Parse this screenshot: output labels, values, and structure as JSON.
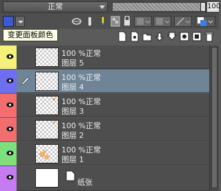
{
  "blend": {
    "mode": "正常",
    "opacity": "100"
  },
  "tooltip": {
    "text": "变更面板颜色"
  },
  "colors": {
    "panel_accent": "#3d59d8",
    "selected_row": "#6f8597"
  },
  "layers": [
    {
      "opacity_mode": "100 %正常",
      "name": "图层 5",
      "strip": "#f5f07a",
      "selected": false,
      "thumb": "checker"
    },
    {
      "opacity_mode": "100 %正常",
      "name": "图层 4",
      "strip": "#6e6ef0",
      "selected": true,
      "thumb": "checker"
    },
    {
      "opacity_mode": "100 %正常",
      "name": "图层 3",
      "strip": "#f26e6e",
      "selected": false,
      "thumb": "checker"
    },
    {
      "opacity_mode": "100 %正常",
      "name": "图层 2",
      "strip": "#f26e6e",
      "selected": false,
      "thumb": "checker"
    },
    {
      "opacity_mode": "100 %正常",
      "name": "图层 1",
      "strip": "#7de07d",
      "selected": false,
      "thumb": "sketch"
    },
    {
      "name": "纸张",
      "strip": "#c47cf0",
      "selected": false,
      "thumb": "paper"
    }
  ]
}
